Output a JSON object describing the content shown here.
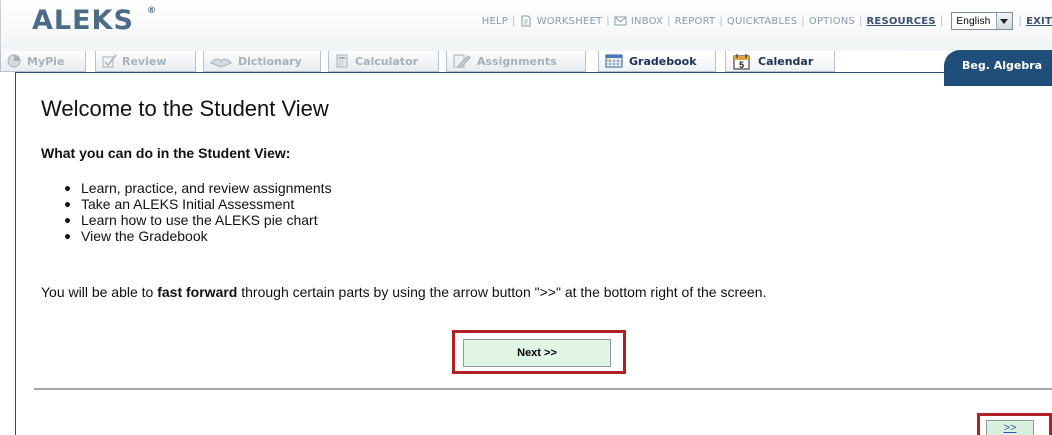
{
  "header": {
    "logo": "ALEKS",
    "logo_mark": "®",
    "nav": {
      "help": "HELP",
      "worksheet": "WORKSHEET",
      "inbox": "INBOX",
      "report": "REPORT",
      "quicktables": "QUICKTABLES",
      "options": "OPTIONS",
      "resources": "RESOURCES",
      "language_value": "English",
      "exit": "EXIT"
    }
  },
  "tabs": [
    {
      "label": "MyPie",
      "icon": "pie-icon",
      "active": false
    },
    {
      "label": "Review",
      "icon": "review-check-icon",
      "active": false
    },
    {
      "label": "Dictionary",
      "icon": "dictionary-book-icon",
      "active": false
    },
    {
      "label": "Calculator",
      "icon": "calculator-icon",
      "active": false
    },
    {
      "label": "Assignments",
      "icon": "assignments-pencil-icon",
      "active": false
    },
    {
      "label": "Gradebook",
      "icon": "gradebook-icon",
      "active": true
    },
    {
      "label": "Calendar",
      "icon": "calendar-icon",
      "active": true
    }
  ],
  "course_tab": "Beg. Algebra",
  "main": {
    "title": "Welcome to the Student View",
    "subheading": "What you can do in the Student View:",
    "bullets": [
      "Learn, practice, and review assignments",
      "Take an ALEKS Initial Assessment",
      "Learn how to use the ALEKS pie chart",
      "View the Gradebook"
    ],
    "ff_before": "You will be able to ",
    "ff_bold": "fast forward",
    "ff_after": " through certain parts by using the arrow button \">>\" at the bottom right of the screen.",
    "next_label": "Next >>",
    "fast_forward_label": ">>"
  },
  "colors": {
    "brand": "#4d6a86",
    "course_tab": "#1f4e7b",
    "highlight_frame": "#b21f24",
    "button_green": "#e2f4e4"
  }
}
